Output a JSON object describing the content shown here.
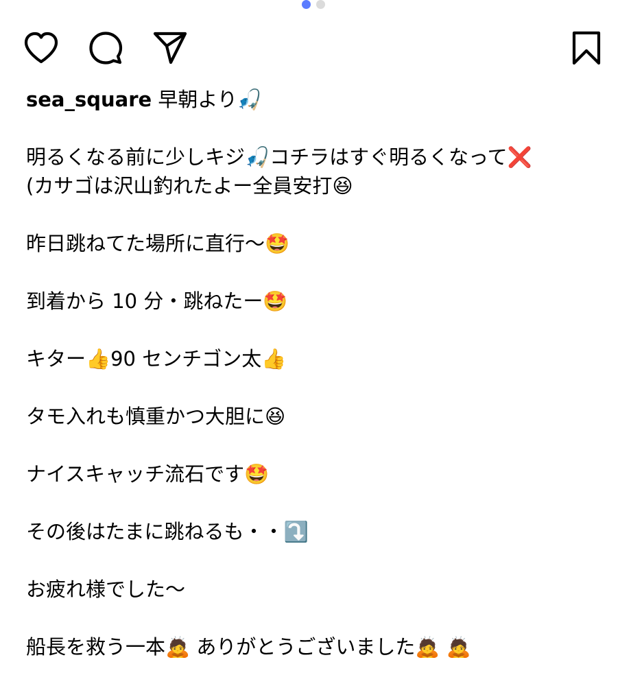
{
  "pagination": {
    "total": 2,
    "active_index": 0,
    "active_color": "#5b7cff",
    "inactive_color": "#dbdbdb"
  },
  "actions": {
    "like_icon": "heart-icon",
    "comment_icon": "comment-bubble-icon",
    "share_icon": "paper-plane-icon",
    "save_icon": "bookmark-icon"
  },
  "post": {
    "username": "sea_square",
    "intro": " 早朝より🎣",
    "paragraphs": [
      {
        "line1": "明るくなる前に少しキジ🎣コチラはすぐ明るくなって❌",
        "line2": "(カサゴは沢山釣れたよー全員安打😆"
      },
      {
        "line1": "昨日跳ねてた場所に直行〜🤩"
      },
      {
        "line1": "到着から 10 分・跳ねたー🤩"
      },
      {
        "line1": "キター👍90 センチゴン太👍"
      },
      {
        "line1": "タモ入れも慎重かつ大胆に😆"
      },
      {
        "line1": "ナイスキャッチ流石です🤩"
      },
      {
        "line1": "その後はたまに跳ねるも・・⤵️"
      },
      {
        "line1": "お疲れ様でした〜"
      },
      {
        "line1": "船長を救う一本🙇 ありがとうございました🙇 🙇"
      }
    ]
  }
}
